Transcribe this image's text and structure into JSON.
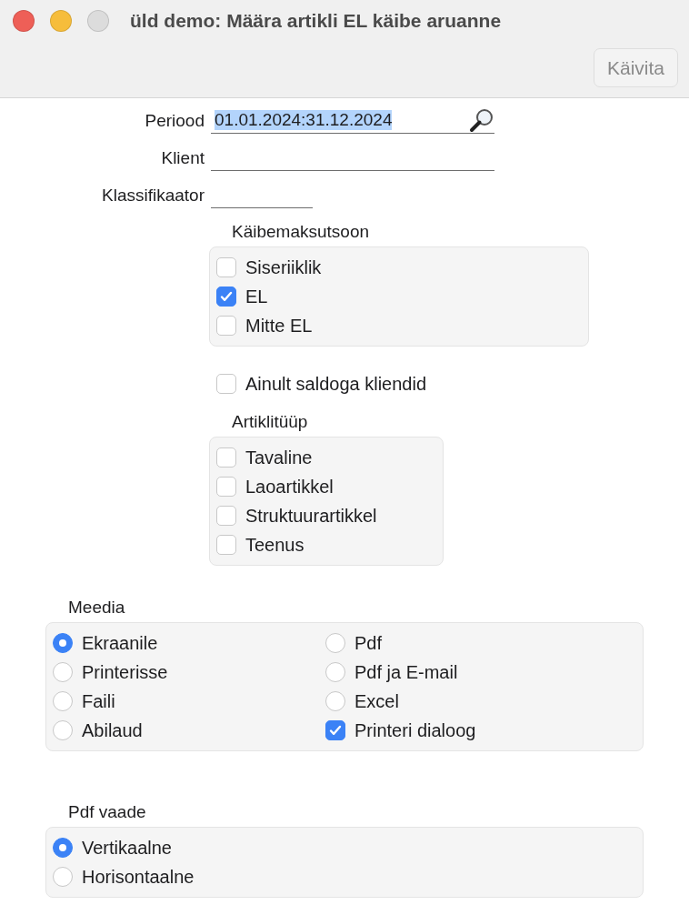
{
  "window": {
    "title": "üld demo: Määra artikli EL käibe aruanne"
  },
  "toolbar": {
    "buttons": [
      {
        "label": "Käivita",
        "disabled": true
      }
    ]
  },
  "fields": [
    {
      "kind": "wide",
      "label": "Periood",
      "value": "01.01.2024:31.12.2024",
      "text_selected": true,
      "lookup": true
    },
    {
      "kind": "wide",
      "label": "Klient",
      "lookup": false
    },
    {
      "kind": "short",
      "label": "Klassifikaator",
      "lookup": false
    }
  ],
  "vat_zone": {
    "title": "Käibemaksutsoon",
    "options": [
      {
        "kind": "checkbox",
        "label": "Siseriiklik",
        "checked": false
      },
      {
        "kind": "checkbox",
        "label": "EL",
        "checked": true
      },
      {
        "kind": "checkbox",
        "label": "Mitte EL",
        "checked": false
      }
    ]
  },
  "balance_only": {
    "kind": "checkbox",
    "label": "Ainult saldoga kliendid",
    "checked": false
  },
  "item_type": {
    "title": "Artiklitüüp",
    "options": [
      {
        "kind": "checkbox",
        "label": "Tavaline",
        "checked": false
      },
      {
        "kind": "checkbox",
        "label": "Laoartikkel",
        "checked": false
      },
      {
        "kind": "checkbox",
        "label": "Struktuurartikkel",
        "checked": false
      },
      {
        "kind": "checkbox",
        "label": "Teenus",
        "checked": false
      }
    ]
  },
  "media": {
    "title": "Meedia",
    "options": [
      {
        "kind": "radio",
        "label": "Ekraanile",
        "selected": true
      },
      {
        "kind": "radio",
        "label": "Pdf",
        "selected": false
      },
      {
        "kind": "radio",
        "label": "Printerisse",
        "selected": false
      },
      {
        "kind": "radio",
        "label": "Pdf ja E-mail",
        "selected": false
      },
      {
        "kind": "radio",
        "label": "Faili",
        "selected": false
      },
      {
        "kind": "radio",
        "label": "Excel",
        "selected": false
      },
      {
        "kind": "radio",
        "label": "Abilaud",
        "selected": false
      },
      {
        "kind": "checkbox",
        "label": "Printeri dialoog",
        "checked": true
      }
    ]
  },
  "pdf_view": {
    "title": "Pdf vaade",
    "options": [
      {
        "kind": "radio",
        "label": "Vertikaalne",
        "selected": true
      },
      {
        "kind": "radio",
        "label": "Horisontaalne",
        "selected": false
      }
    ]
  }
}
